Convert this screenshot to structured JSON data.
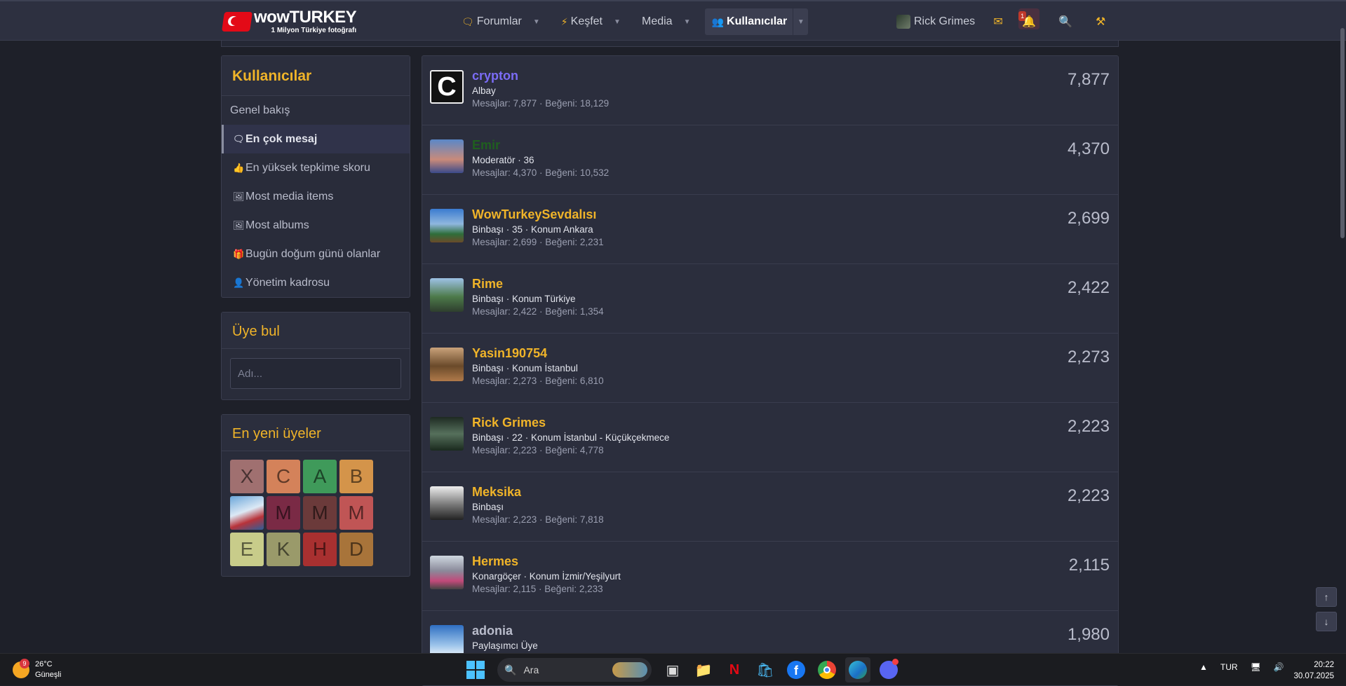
{
  "header": {
    "logo_name": "wowTURKEY",
    "logo_sub": "1 Milyon Türkiye fotoğrafı",
    "nav": [
      {
        "label": "Forumlar",
        "icon": "forum-icon"
      },
      {
        "label": "Keşfet",
        "icon": "bolt-icon"
      },
      {
        "label": "Media",
        "icon": ""
      },
      {
        "label": "Kullanıcılar",
        "icon": "users-icon"
      }
    ],
    "user_name": "Rick Grimes",
    "alerts_badge": "1"
  },
  "sidebar": {
    "title": "Kullanıcılar",
    "items": [
      {
        "label": "Genel bakış"
      },
      {
        "label": "En çok mesaj"
      },
      {
        "label": "En yüksek tepkime skoru"
      },
      {
        "label": "Most media items"
      },
      {
        "label": "Most albums"
      },
      {
        "label": "Bugün doğum günü olanlar"
      },
      {
        "label": "Yönetim kadrosu"
      }
    ],
    "find_title": "Üye bul",
    "find_placeholder": "Adı...",
    "newest_title": "En yeni üyeler",
    "newest": [
      {
        "letter": "X",
        "color": "#a07070"
      },
      {
        "letter": "C",
        "color": "#d4825a"
      },
      {
        "letter": "A",
        "color": "#3f9a5a"
      },
      {
        "letter": "B",
        "color": "#d4944a"
      },
      {
        "letter": "",
        "color": "image"
      },
      {
        "letter": "M",
        "color": "#7a2a45"
      },
      {
        "letter": "M",
        "color": "#6b3a3a"
      },
      {
        "letter": "M",
        "color": "#c05555"
      },
      {
        "letter": "E",
        "color": "#c8cc8a"
      },
      {
        "letter": "K",
        "color": "#9a9a6a"
      },
      {
        "letter": "H",
        "color": "#a83030"
      },
      {
        "letter": "D",
        "color": "#a8743a"
      }
    ]
  },
  "members": [
    {
      "name": "crypton",
      "name_color": "#7b6cf6",
      "title": "Albay",
      "stats": "Mesajlar: 7,877 · Beğeni: 18,129",
      "count": "7,877",
      "avatar": "letter-c"
    },
    {
      "name": "Emir",
      "name_color": "#1f5f1f",
      "title": "Moderatör · 36",
      "stats": "Mesajlar: 4,370 · Beğeni: 10,532",
      "count": "4,370",
      "avatar": "photo"
    },
    {
      "name": "WowTurkeySevdalısı",
      "name_color": "#f0b429",
      "title": "Binbaşı · 35 · Konum Ankara",
      "stats": "Mesajlar: 2,699 · Beğeni: 2,231",
      "count": "2,699",
      "avatar": "photo"
    },
    {
      "name": "Rime",
      "name_color": "#f0b429",
      "title": "Binbaşı · Konum Türkiye",
      "stats": "Mesajlar: 2,422 · Beğeni: 1,354",
      "count": "2,422",
      "avatar": "photo"
    },
    {
      "name": "Yasin190754",
      "name_color": "#f0b429",
      "title": "Binbaşı · Konum İstanbul",
      "stats": "Mesajlar: 2,273 · Beğeni: 6,810",
      "count": "2,273",
      "avatar": "photo"
    },
    {
      "name": "Rick Grimes",
      "name_color": "#f0b429",
      "title": "Binbaşı · 22 · Konum İstanbul - Küçükçekmece",
      "stats": "Mesajlar: 2,223 · Beğeni: 4,778",
      "count": "2,223",
      "avatar": "photo"
    },
    {
      "name": "Meksika",
      "name_color": "#f0b429",
      "title": "Binbaşı",
      "stats": "Mesajlar: 2,223 · Beğeni: 7,818",
      "count": "2,223",
      "avatar": "photo"
    },
    {
      "name": "Hermes",
      "name_color": "#f0b429",
      "title": "Konargöçer · Konum İzmir/Yeşilyurt",
      "stats": "Mesajlar: 2,115 · Beğeni: 2,233",
      "count": "2,115",
      "avatar": "photo"
    },
    {
      "name": "adonia",
      "name_color": "#b9bccb",
      "title": "Paylaşımcı Üye",
      "stats": "",
      "count": "1,980",
      "avatar": "photo"
    }
  ],
  "taskbar": {
    "temp": "26°C",
    "weather": "Güneşli",
    "weather_badge": "9",
    "search": "Ara",
    "lang": "TUR",
    "time": "20:22",
    "date": "30.07.2025"
  }
}
